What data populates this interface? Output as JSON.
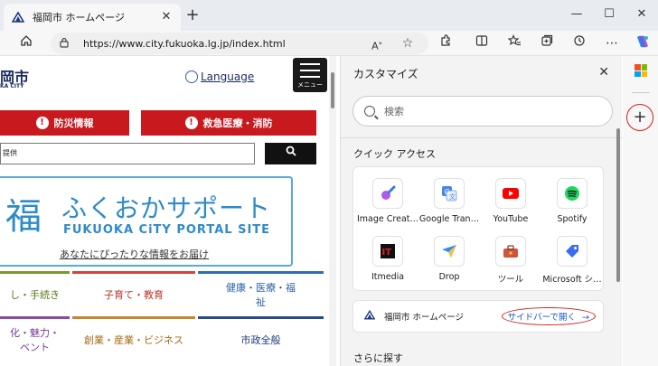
{
  "browser": {
    "tab_title": "福岡市 ホームページ",
    "new_tab": "+",
    "url": "https://www.city.fukuoka.lg.jp/index.html",
    "win_min": "—",
    "win_max": "☐",
    "win_close": "✕"
  },
  "page": {
    "logo_fragment": "岡市",
    "logo_sub": "KA CITY",
    "language": "Language",
    "menu_label": "メニュー",
    "buttons": [
      "防災情報",
      "救急医療・消防"
    ],
    "search_placeholder": "提供",
    "search_button": "🔍",
    "portal": {
      "mark": "福",
      "jp": "ふくおかサポート",
      "en": "FUKUOKA CiTY PORTAL SITE",
      "link": "あなたにぴったりな情報をお届け"
    },
    "categories": [
      {
        "label": "し・手続き",
        "color": "#7a9a2e",
        "text": "#5a7a14"
      },
      {
        "label": "子育て・教育",
        "color": "#d2453a",
        "text": "#c2352a"
      },
      {
        "label": "健康・医療・福祉",
        "color": "#2f6db5",
        "text": "#2a5ea5"
      },
      {
        "label": "化・魅力・ベント",
        "color": "#8a4aa8",
        "text": "#7a3a98"
      },
      {
        "label": "創業・産業・ビジネス",
        "color": "#c9862a",
        "text": "#a86a18"
      },
      {
        "label": "市政全般",
        "color": "#2a4a8a",
        "text": "#1a3a7a"
      }
    ]
  },
  "panel": {
    "title": "カスタマイズ",
    "search_placeholder": "検索",
    "quick_access_title": "クイック アクセス",
    "quick_access": [
      {
        "name": "Image Creat…",
        "icon": "image-creator-icon"
      },
      {
        "name": "Google Tran…",
        "icon": "google-translate-icon"
      },
      {
        "name": "YouTube",
        "icon": "youtube-icon"
      },
      {
        "name": "Spotify",
        "icon": "spotify-icon"
      },
      {
        "name": "Itmedia",
        "icon": "itmedia-icon"
      },
      {
        "name": "Drop",
        "icon": "drop-icon"
      },
      {
        "name": "ツール",
        "icon": "tools-icon"
      },
      {
        "name": "Microsoft シ…",
        "icon": "microsoft-shopping-icon"
      }
    ],
    "current_site": "福岡市 ホームページ",
    "open_in_sidebar": "サイドバーで開く",
    "arrow": "→",
    "more_title": "さらに探す"
  },
  "rail": {
    "add": "+"
  }
}
